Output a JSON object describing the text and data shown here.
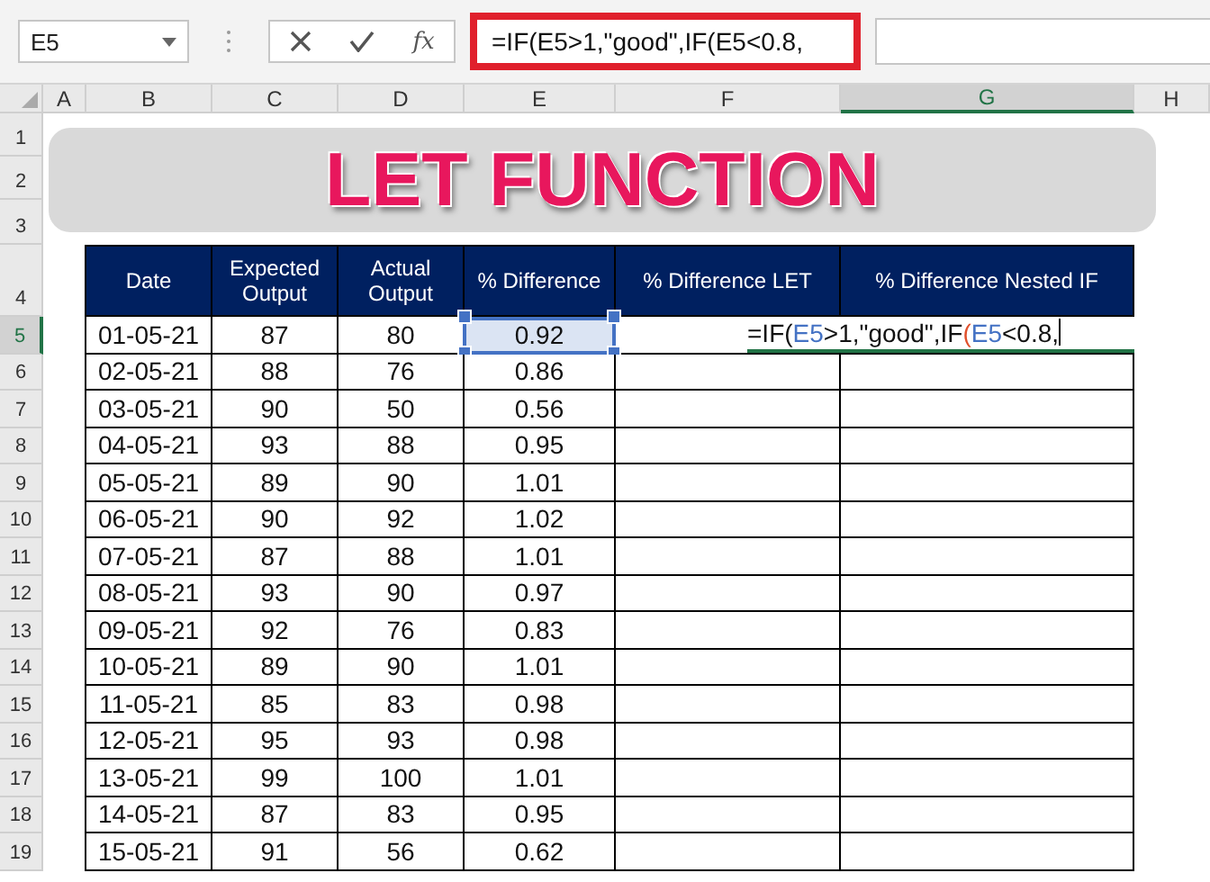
{
  "formula_bar": {
    "name_box": "E5",
    "function_label": "fx",
    "formula": "=IF(E5>1,\"good\",IF(E5<0.8,",
    "highlighted": true
  },
  "columns": [
    {
      "label": "A",
      "selected": false
    },
    {
      "label": "B",
      "selected": false
    },
    {
      "label": "C",
      "selected": false
    },
    {
      "label": "D",
      "selected": false
    },
    {
      "label": "E",
      "selected": false
    },
    {
      "label": "F",
      "selected": false
    },
    {
      "label": "G",
      "selected": true
    },
    {
      "label": "H",
      "selected": false
    }
  ],
  "row_numbers": [
    {
      "label": "1",
      "selected": false
    },
    {
      "label": "2",
      "selected": false
    },
    {
      "label": "3",
      "selected": false
    },
    {
      "label": "4",
      "selected": false
    },
    {
      "label": "5",
      "selected": true
    },
    {
      "label": "6",
      "selected": false
    },
    {
      "label": "7",
      "selected": false
    },
    {
      "label": "8",
      "selected": false
    },
    {
      "label": "9",
      "selected": false
    },
    {
      "label": "10",
      "selected": false
    },
    {
      "label": "11",
      "selected": false
    },
    {
      "label": "12",
      "selected": false
    },
    {
      "label": "13",
      "selected": false
    },
    {
      "label": "14",
      "selected": false
    },
    {
      "label": "15",
      "selected": false
    },
    {
      "label": "16",
      "selected": false
    },
    {
      "label": "17",
      "selected": false
    },
    {
      "label": "18",
      "selected": false
    },
    {
      "label": "19",
      "selected": false
    }
  ],
  "title": "LET FUNCTION",
  "table": {
    "columns": [
      "Date",
      "Expected Output",
      "Actual Output",
      "% Difference",
      "% Difference LET",
      "% Difference Nested IF"
    ],
    "rows": [
      {
        "date": "01-05-21",
        "expected": "87",
        "actual": "80",
        "difference": "0.92",
        "selected": true
      },
      {
        "date": "02-05-21",
        "expected": "88",
        "actual": "76",
        "difference": "0.86",
        "selected": false
      },
      {
        "date": "03-05-21",
        "expected": "90",
        "actual": "50",
        "difference": "0.56",
        "selected": false
      },
      {
        "date": "04-05-21",
        "expected": "93",
        "actual": "88",
        "difference": "0.95",
        "selected": false
      },
      {
        "date": "05-05-21",
        "expected": "89",
        "actual": "90",
        "difference": "1.01",
        "selected": false
      },
      {
        "date": "06-05-21",
        "expected": "90",
        "actual": "92",
        "difference": "1.02",
        "selected": false
      },
      {
        "date": "07-05-21",
        "expected": "87",
        "actual": "88",
        "difference": "1.01",
        "selected": false
      },
      {
        "date": "08-05-21",
        "expected": "93",
        "actual": "90",
        "difference": "0.97",
        "selected": false
      },
      {
        "date": "09-05-21",
        "expected": "92",
        "actual": "76",
        "difference": "0.83",
        "selected": false
      },
      {
        "date": "10-05-21",
        "expected": "89",
        "actual": "90",
        "difference": "1.01",
        "selected": false
      },
      {
        "date": "11-05-21",
        "expected": "85",
        "actual": "83",
        "difference": "0.98",
        "selected": false
      },
      {
        "date": "12-05-21",
        "expected": "95",
        "actual": "93",
        "difference": "0.98",
        "selected": false
      },
      {
        "date": "13-05-21",
        "expected": "99",
        "actual": "100",
        "difference": "1.01",
        "selected": false
      },
      {
        "date": "14-05-21",
        "expected": "87",
        "actual": "83",
        "difference": "0.95",
        "selected": false
      },
      {
        "date": "15-05-21",
        "expected": "91",
        "actual": "56",
        "difference": "0.62",
        "selected": false
      }
    ]
  },
  "cell_edit": {
    "segments": [
      {
        "text": "=IF(",
        "kind": "plain"
      },
      {
        "text": "E5",
        "kind": "ref"
      },
      {
        "text": ">1,\"good\",IF",
        "kind": "plain"
      },
      {
        "text": "(",
        "kind": "paren"
      },
      {
        "text": "E5",
        "kind": "ref"
      },
      {
        "text": "<0.8,",
        "kind": "plain"
      }
    ]
  }
}
